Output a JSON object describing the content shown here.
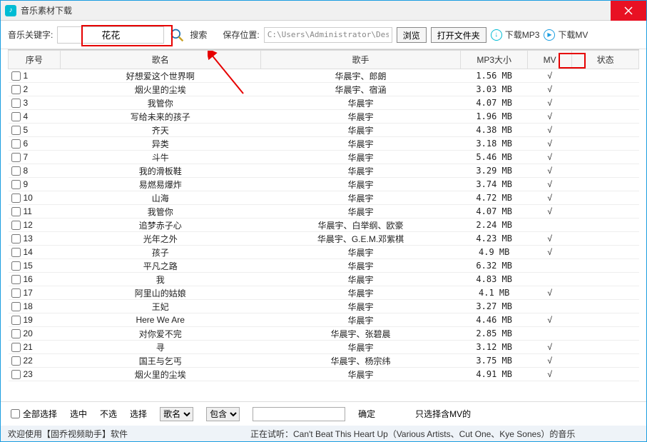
{
  "titlebar": {
    "title": "音乐素材下载"
  },
  "toolbar": {
    "keyword_label": "音乐关键字:",
    "keyword_value": "花花",
    "search_label": "搜索",
    "savepath_label": "保存位置:",
    "savepath_value": "C:\\Users\\Administrator\\Deskto",
    "browse_label": "浏览",
    "openfolder_label": "打开文件夹",
    "download_mp3": "下载MP3",
    "download_mv": "下载MV"
  },
  "columns": {
    "idx": "序号",
    "song": "歌名",
    "singer": "歌手",
    "size": "MP3大小",
    "mv": "MV",
    "state": "状态"
  },
  "rows": [
    {
      "idx": "1",
      "song": "好想爱这个世界啊",
      "singer": "华晨宇、郎朗",
      "size": "1.56 MB",
      "mv": "√",
      "state": ""
    },
    {
      "idx": "2",
      "song": "烟火里的尘埃",
      "singer": "华晨宇、宿涵",
      "size": "3.03 MB",
      "mv": "√",
      "state": ""
    },
    {
      "idx": "3",
      "song": "我管你",
      "singer": "华晨宇",
      "size": "4.07 MB",
      "mv": "√",
      "state": ""
    },
    {
      "idx": "4",
      "song": "写给未来的孩子",
      "singer": "华晨宇",
      "size": "1.96 MB",
      "mv": "√",
      "state": ""
    },
    {
      "idx": "5",
      "song": "齐天",
      "singer": "华晨宇",
      "size": "4.38 MB",
      "mv": "√",
      "state": ""
    },
    {
      "idx": "6",
      "song": "异类",
      "singer": "华晨宇",
      "size": "3.18 MB",
      "mv": "√",
      "state": ""
    },
    {
      "idx": "7",
      "song": "斗牛",
      "singer": "华晨宇",
      "size": "5.46 MB",
      "mv": "√",
      "state": ""
    },
    {
      "idx": "8",
      "song": "我的滑板鞋",
      "singer": "华晨宇",
      "size": "3.29 MB",
      "mv": "√",
      "state": ""
    },
    {
      "idx": "9",
      "song": "易燃易爆炸",
      "singer": "华晨宇",
      "size": "3.74 MB",
      "mv": "√",
      "state": ""
    },
    {
      "idx": "10",
      "song": "山海",
      "singer": "华晨宇",
      "size": "4.72 MB",
      "mv": "√",
      "state": ""
    },
    {
      "idx": "11",
      "song": "我管你",
      "singer": "华晨宇",
      "size": "4.07 MB",
      "mv": "√",
      "state": ""
    },
    {
      "idx": "12",
      "song": "追梦赤子心",
      "singer": "华晨宇、白举纲、欧豪",
      "size": "2.24 MB",
      "mv": "",
      "state": ""
    },
    {
      "idx": "13",
      "song": "光年之外",
      "singer": "华晨宇、G.E.M.邓紫棋",
      "size": "4.23 MB",
      "mv": "√",
      "state": ""
    },
    {
      "idx": "14",
      "song": "孩子",
      "singer": "华晨宇",
      "size": "4.9 MB",
      "mv": "√",
      "state": ""
    },
    {
      "idx": "15",
      "song": "平凡之路",
      "singer": "华晨宇",
      "size": "6.32 MB",
      "mv": "",
      "state": ""
    },
    {
      "idx": "16",
      "song": "我",
      "singer": "华晨宇",
      "size": "4.83 MB",
      "mv": "",
      "state": ""
    },
    {
      "idx": "17",
      "song": "阿里山的姑娘",
      "singer": "华晨宇",
      "size": "4.1 MB",
      "mv": "√",
      "state": ""
    },
    {
      "idx": "18",
      "song": "王妃",
      "singer": "华晨宇",
      "size": "3.27 MB",
      "mv": "",
      "state": ""
    },
    {
      "idx": "19",
      "song": "Here We Are",
      "singer": "华晨宇",
      "size": "4.46 MB",
      "mv": "√",
      "state": ""
    },
    {
      "idx": "20",
      "song": "对你爱不完",
      "singer": "华晨宇、张碧晨",
      "size": "2.85 MB",
      "mv": "",
      "state": ""
    },
    {
      "idx": "21",
      "song": "寻",
      "singer": "华晨宇",
      "size": "3.12 MB",
      "mv": "√",
      "state": ""
    },
    {
      "idx": "22",
      "song": "国王与乞丐",
      "singer": "华晨宇、杨宗纬",
      "size": "3.75 MB",
      "mv": "√",
      "state": ""
    },
    {
      "idx": "23",
      "song": "烟火里的尘埃",
      "singer": "华晨宇",
      "size": "4.91 MB",
      "mv": "√",
      "state": ""
    }
  ],
  "bottombar": {
    "select_all": "全部选择",
    "sel_checked": "选中",
    "sel_unchecked": "不选",
    "filter_label": "选择",
    "filter_field": "歌名",
    "filter_op": "包含",
    "ok": "确定",
    "only_mv": "只选择含MV的"
  },
  "statusbar": {
    "left": "欢迎使用【固乔视频助手】软件",
    "right": "正在试听：Can't Beat This Heart Up（Various Artists、Cut One、Kye Sones）的音乐"
  }
}
